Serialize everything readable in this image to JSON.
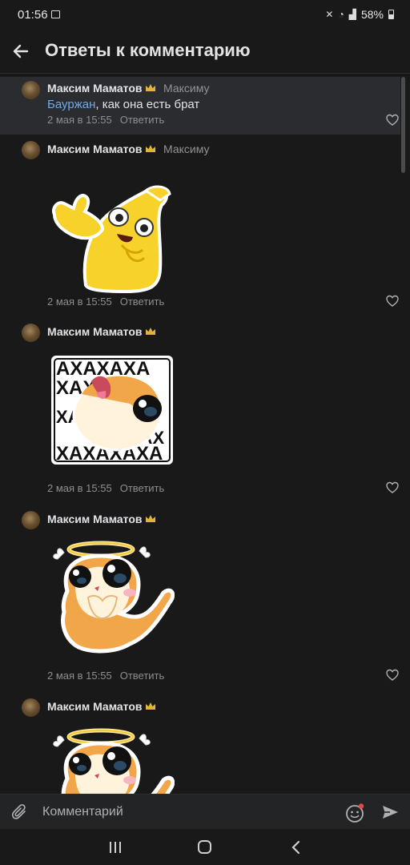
{
  "status_bar": {
    "time": "01:56",
    "battery": "58%"
  },
  "header": {
    "title": "Ответы к комментарию"
  },
  "comments": [
    {
      "author": "Максим Маматов",
      "reply_to": "Максиму",
      "mention": "Бауржан",
      "text": ", как она есть брат",
      "date": "2 мая в 15:55",
      "reply_label": "Ответить"
    },
    {
      "author": "Максим Маматов",
      "reply_to": "Максиму",
      "sticker": "banana-thumbs-up-sticker",
      "date": "2 мая в 15:55",
      "reply_label": "Ответить"
    },
    {
      "author": "Максим Маматов",
      "sticker": "hamster-laughing-sticker",
      "sticker_text": [
        "АХАХАХА",
        "ХАХА",
        "ХА",
        "АХАХ",
        "ХАХАХАХА"
      ],
      "date": "2 мая в 15:55",
      "reply_label": "Ответить"
    },
    {
      "author": "Максим Маматов",
      "sticker": "hamster-angel-sticker",
      "date": "2 мая в 15:55",
      "reply_label": "Ответить"
    },
    {
      "author": "Максим Маматов",
      "sticker": "hamster-angel-sticker"
    }
  ],
  "input": {
    "placeholder": "Комментарий"
  },
  "colors": {
    "background": "#19191a",
    "accent": "#71aaeb",
    "highlight": "#2a2c30"
  }
}
